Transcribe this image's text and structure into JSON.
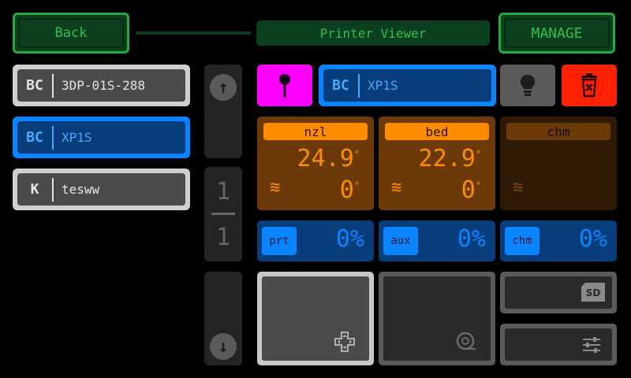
{
  "header": {
    "back_label": "Back",
    "title": "Printer Viewer",
    "manage_label": "MANAGE"
  },
  "printers": [
    {
      "tag": "BC",
      "name": "3DP-01S-288",
      "state": "normal"
    },
    {
      "tag": "BC",
      "name": "XP1S",
      "state": "selected"
    },
    {
      "tag": "K",
      "name": "tesww",
      "state": "normal"
    }
  ],
  "pager": {
    "current": "1",
    "total": "1"
  },
  "selected_printer": {
    "tag": "BC",
    "name": "XP1S"
  },
  "temperatures": [
    {
      "label": "nzl",
      "current": "24.9",
      "target": "0",
      "unit": "°",
      "active": true
    },
    {
      "label": "bed",
      "current": "22.9",
      "target": "0",
      "unit": "°",
      "active": true
    },
    {
      "label": "chm",
      "current": "",
      "target": "",
      "unit": "",
      "active": false
    }
  ],
  "fans": [
    {
      "label": "prt",
      "value": "0%"
    },
    {
      "label": "aux",
      "value": "0%"
    },
    {
      "label": "chm",
      "value": "0%"
    }
  ],
  "icons": {
    "back": "arrow-up-icon",
    "forward": "arrow-down-icon",
    "pin": "pin-icon",
    "light": "lightbulb-icon",
    "delete": "trash-icon",
    "heater": "heater-icon",
    "control": "dpad-icon",
    "filament": "filament-spool-icon",
    "sd": "sd-card-icon",
    "settings": "sliders-icon"
  },
  "colors": {
    "green": "#2fbf55",
    "blue": "#0a84ff",
    "orange": "#ff8c00",
    "magenta": "#ff00ff",
    "red": "#ff2200"
  }
}
